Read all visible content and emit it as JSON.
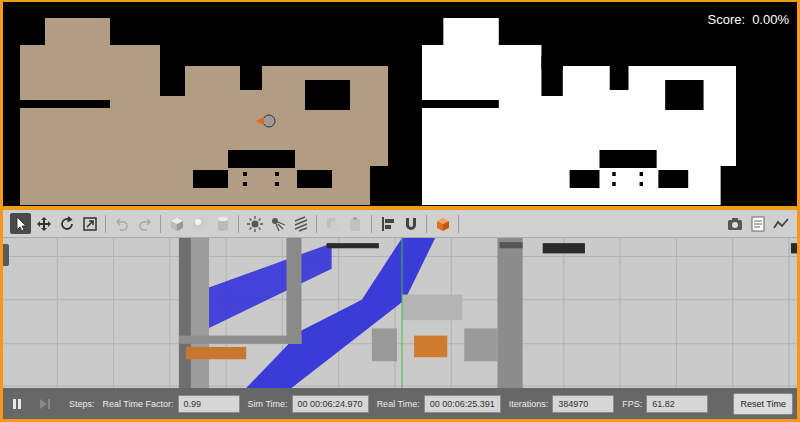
{
  "top_panel": {
    "score": {
      "label": "Score:",
      "value": "0.00%"
    }
  },
  "toolbar": {
    "tools": [
      {
        "kind": "select",
        "selected": true,
        "disabled": false
      },
      {
        "kind": "translate",
        "selected": false,
        "disabled": false
      },
      {
        "kind": "rotate",
        "selected": false,
        "disabled": false
      },
      {
        "kind": "scale",
        "selected": false,
        "disabled": false
      },
      {
        "kind": "undo",
        "selected": false,
        "disabled": true
      },
      {
        "kind": "redo",
        "selected": false,
        "disabled": true
      },
      {
        "kind": "box",
        "selected": false,
        "disabled": false
      },
      {
        "kind": "sphere",
        "selected": false,
        "disabled": false
      },
      {
        "kind": "cylinder",
        "selected": false,
        "disabled": false
      },
      {
        "kind": "point-light",
        "selected": false,
        "disabled": false
      },
      {
        "kind": "spot-light",
        "selected": false,
        "disabled": false
      },
      {
        "kind": "directional-light",
        "selected": false,
        "disabled": false
      },
      {
        "kind": "copy",
        "selected": false,
        "disabled": true
      },
      {
        "kind": "paste",
        "selected": false,
        "disabled": true
      },
      {
        "kind": "align",
        "selected": false,
        "disabled": false
      },
      {
        "kind": "snap",
        "selected": false,
        "disabled": false
      },
      {
        "kind": "view",
        "selected": false,
        "disabled": false
      }
    ],
    "right_tools": [
      {
        "kind": "screenshot",
        "selected": false
      },
      {
        "kind": "log",
        "selected": false
      },
      {
        "kind": "plot",
        "selected": false
      }
    ]
  },
  "status_bar": {
    "paused": false,
    "steps_label": "Steps:",
    "fields": [
      {
        "label": "Real Time Factor:",
        "value": "0.99"
      },
      {
        "label": "Sim Time:",
        "value": "00 00:06:24.970"
      },
      {
        "label": "Real Time:",
        "value": "00 00:06:25.391"
      },
      {
        "label": "Iterations:",
        "value": "384970"
      },
      {
        "label": "FPS:",
        "value": "61.82"
      }
    ],
    "reset_button": "Reset Time"
  }
}
